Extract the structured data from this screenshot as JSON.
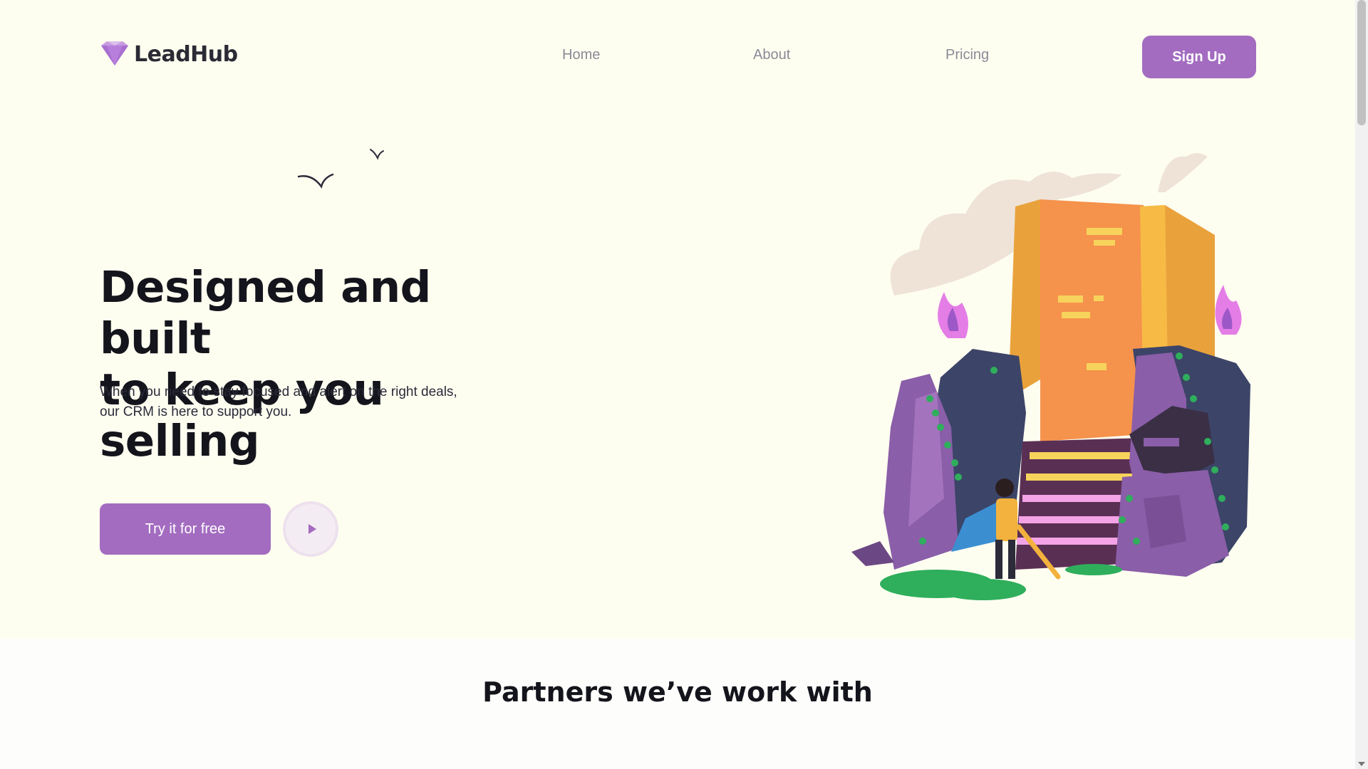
{
  "brand": {
    "name": "LeadHub",
    "logo_icon": "diamond-icon",
    "accent": "#a36cc0"
  },
  "nav": {
    "items": [
      {
        "label": "Home"
      },
      {
        "label": "About"
      },
      {
        "label": "Pricing"
      }
    ],
    "signup_label": "Sign Up"
  },
  "hero": {
    "title_line1": "Designed and built",
    "title_line2": "to keep you selling",
    "subtitle": "When you need to stay focused and alert on the right deals, our CRM is here to support you.",
    "cta_label": "Try it for free",
    "play_icon": "play-icon"
  },
  "partners": {
    "title": "Partners we’ve work with"
  },
  "colors": {
    "background": "#fefef0",
    "button": "#a36cc0",
    "heading": "#14141c"
  }
}
